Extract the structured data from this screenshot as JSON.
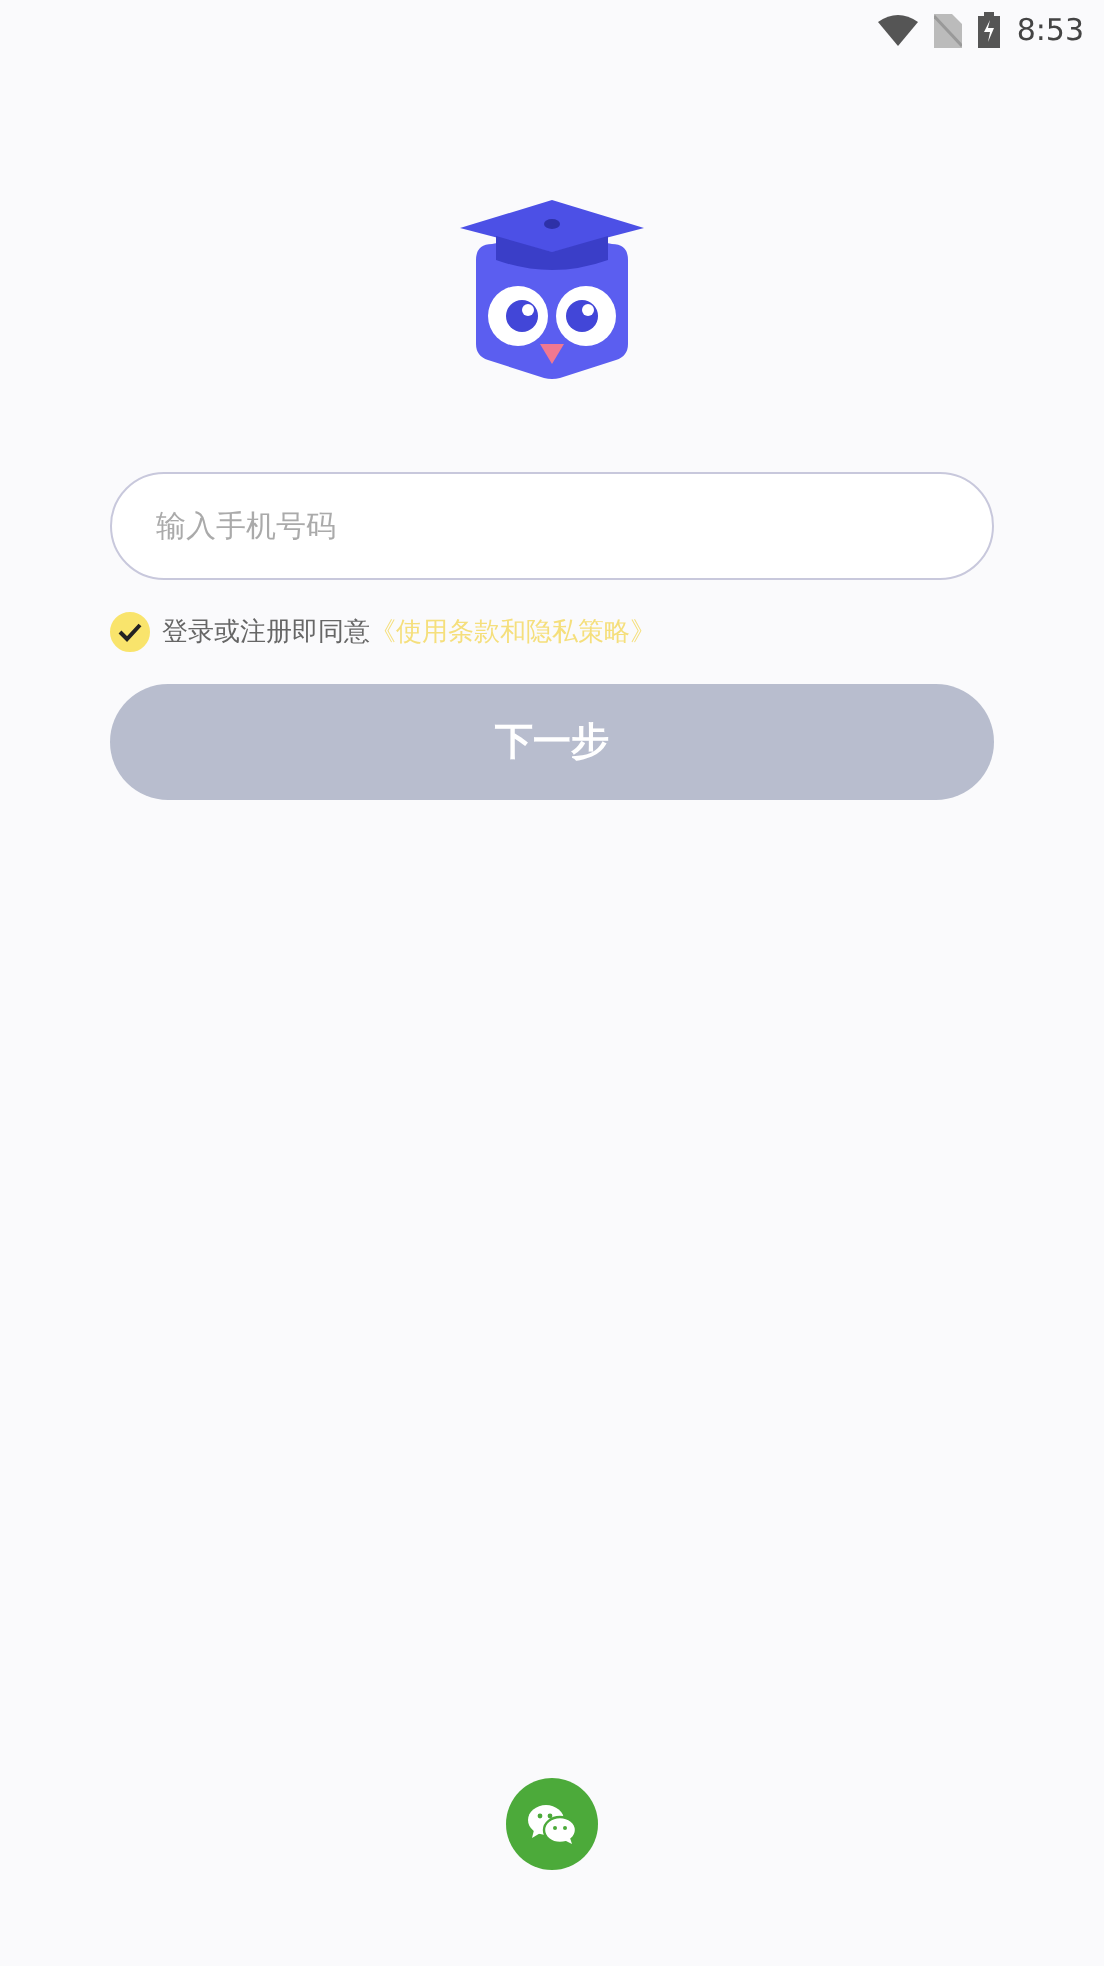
{
  "status_bar": {
    "time": "8:53"
  },
  "phone_field": {
    "placeholder": "输入手机号码"
  },
  "agreement": {
    "checked": true,
    "text": "登录或注册即同意",
    "link": "《使用条款和隐私策略》"
  },
  "next_button": {
    "label": "下一步",
    "disabled": true
  }
}
